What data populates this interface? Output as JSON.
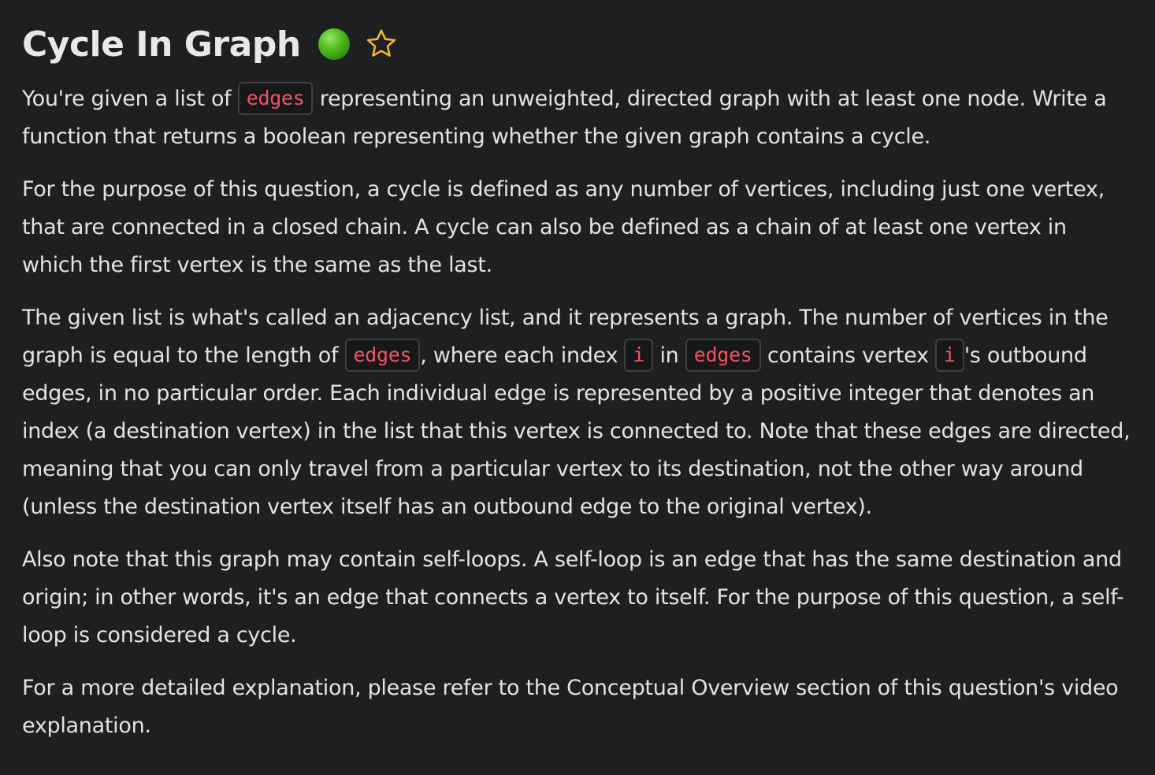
{
  "title": "Cycle In Graph",
  "difficulty_color": "#4fbf21",
  "favorite_icon": "star-outline-icon",
  "paragraphs": {
    "p1": {
      "a": "You're given a list of",
      "code1": "edges",
      "b": "representing an unweighted, directed graph with at least one node. Write a function that returns a boolean representing whether the given graph contains a cycle."
    },
    "p2": {
      "text": "For the purpose of this question, a cycle is defined as any number of vertices, including just one vertex, that are connected in a closed chain. A cycle can also be defined as a chain of at least one vertex in which the first vertex is the same as the last."
    },
    "p3": {
      "a": "The given list is what's called an adjacency list, and it represents a graph. The number of vertices in the graph is equal to the length of",
      "code1": "edges",
      "b": ", where each index",
      "code2": "i",
      "c": "in",
      "code3": "edges",
      "d": "contains vertex",
      "code4": "i",
      "e": "'s outbound edges, in no particular order. Each individual edge is represented by a positive integer that denotes an index (a destination vertex) in the list that this vertex is connected to. Note that these edges are directed, meaning that you can only travel from a particular vertex to its destination, not the other way around (unless the destination vertex itself has an outbound edge to the original vertex)."
    },
    "p4": {
      "text": "Also note that this graph may contain self-loops. A self-loop is an edge that has the same destination and origin; in other words, it's an edge that connects a vertex to itself. For the purpose of this question, a self-loop is considered a cycle."
    },
    "p5": {
      "text": "For a more detailed explanation, please refer to the Conceptual Overview section of this question's video explanation."
    }
  }
}
